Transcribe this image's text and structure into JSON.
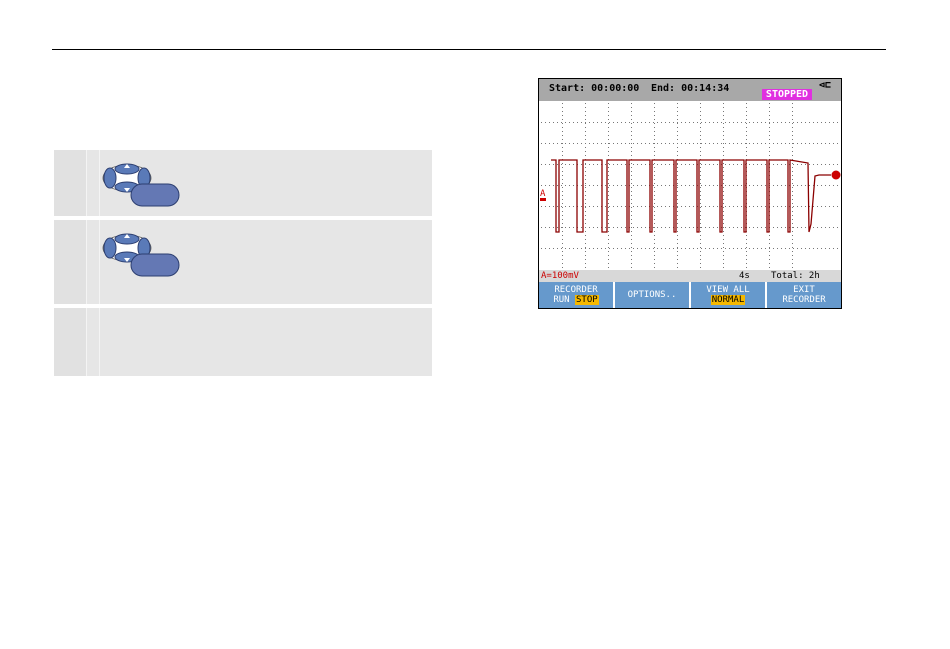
{
  "scope": {
    "start": "Start: 00:00:00",
    "end": "End:  00:14:34",
    "state": "STOPPED",
    "plug_icon": "plug-icon",
    "channel_marker": "A",
    "scale": "A=100mV",
    "timebase": "4s",
    "total": "Total: 2h",
    "softkeys": [
      {
        "line1": "RECORDER",
        "line2a": "RUN ",
        "line2b": "STOP"
      },
      {
        "line1": "OPTIONS..",
        "line2a": "",
        "line2b": ""
      },
      {
        "line1": "VIEW ALL",
        "line2a": "",
        "line2b": "NORMAL"
      },
      {
        "line1": "EXIT",
        "line2a": "RECORDER",
        "line2b": ""
      }
    ],
    "colors": {
      "trace": "#8b0000",
      "badge": "#e030e0",
      "softkey": "#6699cc",
      "highlight": "#f5b800"
    }
  },
  "icons": {
    "keypad": "arrow-keypad-icon"
  }
}
